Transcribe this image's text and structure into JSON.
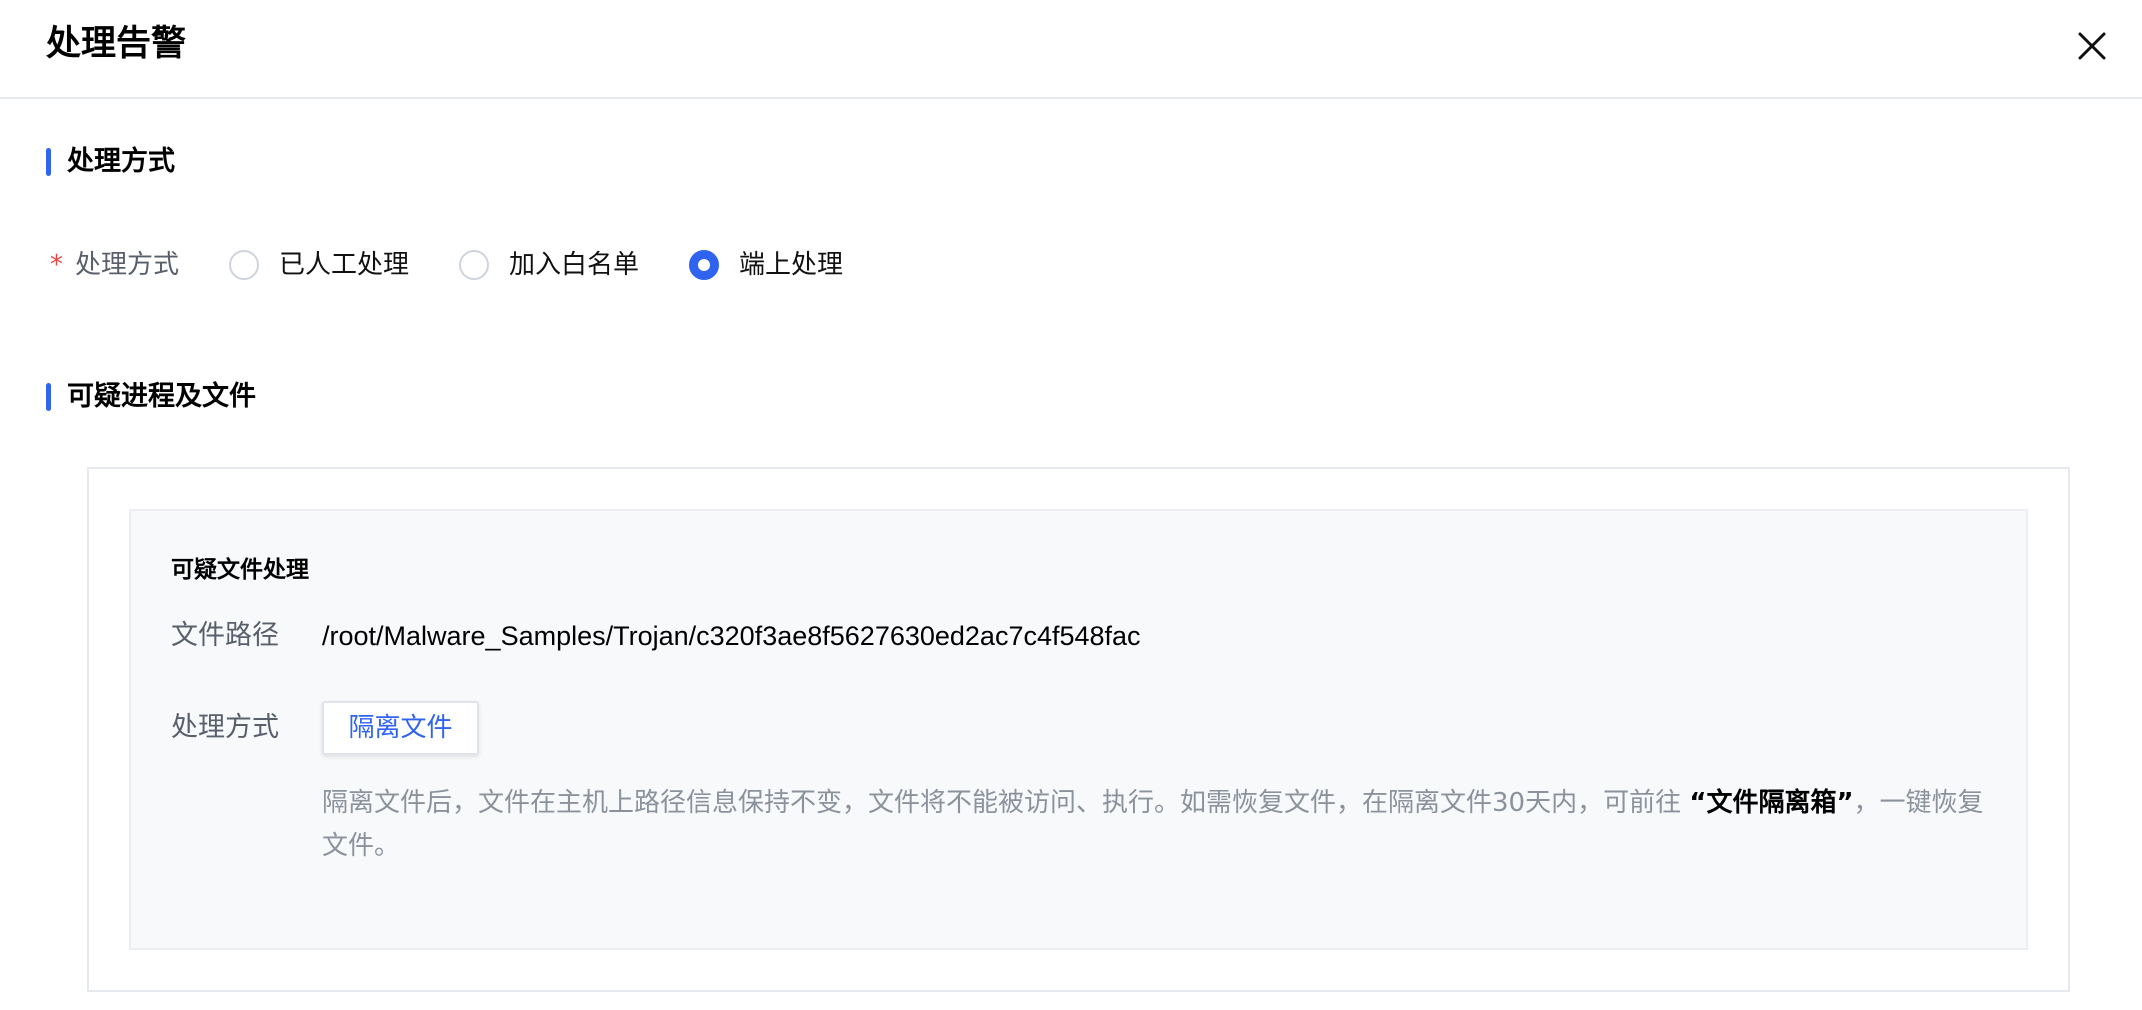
{
  "header": {
    "title": "处理告警",
    "close_icon": "close-icon"
  },
  "section_handling": {
    "title": "处理方式"
  },
  "handling_form": {
    "required_mark": "*",
    "label": "处理方式",
    "options": [
      {
        "label": "已人工处理",
        "checked": false
      },
      {
        "label": "加入白名单",
        "checked": false
      },
      {
        "label": "端上处理",
        "checked": true
      }
    ]
  },
  "section_suspicious": {
    "title": "可疑进程及文件"
  },
  "suspicious_file": {
    "title": "可疑文件处理",
    "path_label": "文件路径",
    "path_value": "/root/Malware_Samples/Trojan/c320f3ae8f5627630ed2ac7c4f548fac",
    "method_label": "处理方式",
    "isolate_button": "隔离文件",
    "description_before": "隔离文件后，文件在主机上路径信息保持不变，文件将不能被访问、执行。如需恢复文件，在隔离文件30天内，可前往 ",
    "description_link": "“文件隔离箱”",
    "description_after": "，一键恢复文件。"
  },
  "colors": {
    "accent": "#2f63f0",
    "required": "#e54545",
    "muted_text": "#8c929c",
    "label_text": "#595f6b",
    "border": "#e6e9ef",
    "panel_bg": "#f8f9fb"
  }
}
